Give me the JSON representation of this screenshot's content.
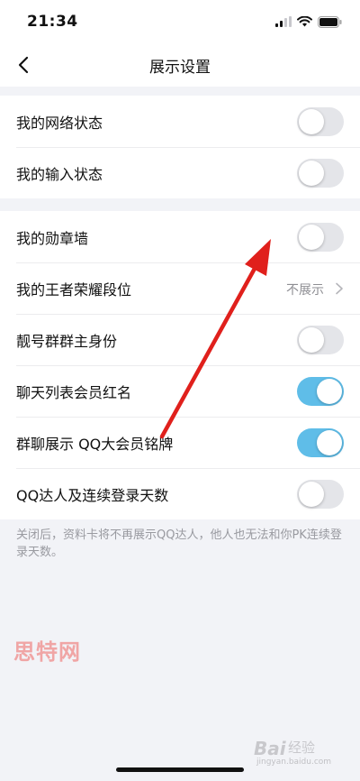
{
  "status_bar": {
    "time": "21:34"
  },
  "nav": {
    "title": "展示设置"
  },
  "groups": [
    {
      "rows": [
        {
          "label": "我的网络状态",
          "toggle": false
        },
        {
          "label": "我的输入状态",
          "toggle": false
        }
      ]
    },
    {
      "rows": [
        {
          "label": "我的勋章墙",
          "toggle": false
        },
        {
          "label": "我的王者荣耀段位",
          "value": "不展示"
        },
        {
          "label": "靓号群群主身份",
          "toggle": false
        },
        {
          "label": "聊天列表会员红名",
          "toggle": true
        },
        {
          "label": "群聊展示 QQ大会员铭牌",
          "toggle": true
        },
        {
          "label": "QQ达人及连续登录天数",
          "toggle": false
        }
      ]
    }
  ],
  "footnote": "关闭后，资料卡将不再展示QQ达人，他人也无法和你PK连续登录天数。",
  "watermark": {
    "site": "思特网",
    "baidu": "Bai",
    "baidu_sub": "经验",
    "url": "jingyan.baidu.com"
  },
  "colors": {
    "toggle_on": "#5fbde8",
    "toggle_off": "#e4e5e9",
    "annotation_arrow": "#e0201c"
  },
  "icons": [
    "back-icon",
    "signal-icon",
    "wifi-icon",
    "battery-icon",
    "chevron-right-icon"
  ]
}
